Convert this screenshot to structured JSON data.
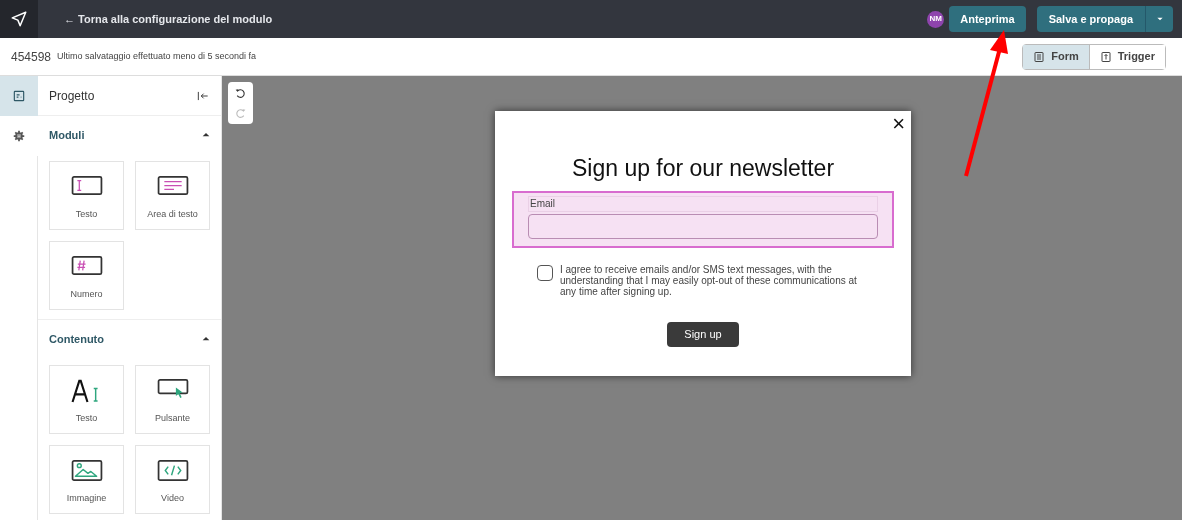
{
  "topbar": {
    "back_link": "← Torna alla configurazione del modulo",
    "avatar": "NM",
    "preview_button": "Anteprima",
    "save_button": "Salva e propaga"
  },
  "subbar": {
    "id": "454598",
    "save_status": "Ultimo salvataggio effettuato meno di 5 secondi fa",
    "view_tabs": [
      {
        "label": "Form",
        "kind": "form",
        "selected": true
      },
      {
        "label": "Trigger",
        "kind": "trigger",
        "selected": false
      }
    ]
  },
  "rail": [
    {
      "kind": "layout",
      "selected": true
    },
    {
      "kind": "settings",
      "selected": false
    }
  ],
  "panel": {
    "title": "Progetto",
    "sections": [
      {
        "title": "Moduli",
        "expanded": true,
        "items": [
          {
            "label": "Testo",
            "kind": "text-field"
          },
          {
            "label": "Area di testo",
            "kind": "textarea"
          },
          {
            "label": "Numero",
            "kind": "number"
          }
        ]
      },
      {
        "title": "Contenuto",
        "expanded": true,
        "items": [
          {
            "label": "Testo",
            "kind": "text"
          },
          {
            "label": "Pulsante",
            "kind": "button"
          },
          {
            "label": "Immagine",
            "kind": "image"
          },
          {
            "label": "Video",
            "kind": "video"
          }
        ]
      }
    ]
  },
  "popup": {
    "close": "×",
    "title": "Sign up for our newsletter",
    "email_label": "Email",
    "consent": {
      "checked": false,
      "text": "I agree to receive emails and/or SMS text messages, with the understanding that I may easily opt-out of these communications at any time after signing up."
    },
    "submit": "Sign up"
  }
}
